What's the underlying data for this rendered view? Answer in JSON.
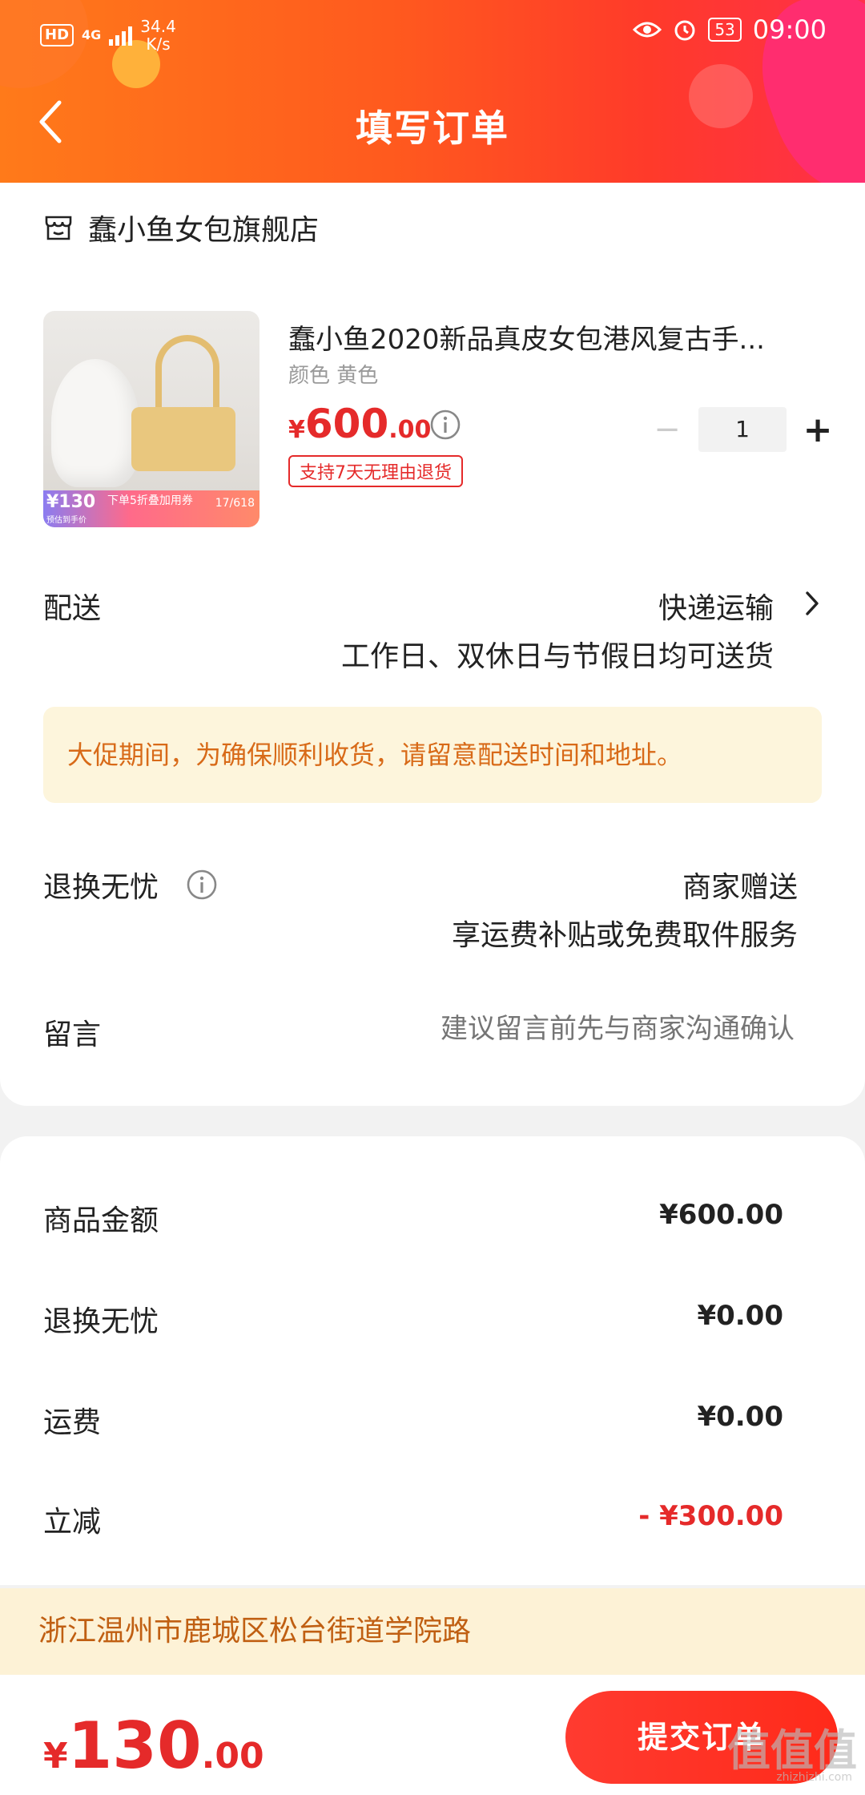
{
  "status_bar": {
    "hd": "HD",
    "network": "4G",
    "speed_value": "34.4",
    "speed_unit": "K/s",
    "battery": "53",
    "time": "09:00"
  },
  "nav": {
    "title": "填写订单"
  },
  "store": {
    "name": "蠢小鱼女包旗舰店"
  },
  "product": {
    "title": "蠢小鱼2020新品真皮女包港风复古手...",
    "spec": "颜色 黄色",
    "price_symbol": "¥",
    "price_int": "600",
    "price_dec": ".00",
    "tag": "支持7天无理由退货",
    "quantity": "1",
    "qty_minus": "−",
    "qty_plus": "+",
    "image_promo": {
      "price": "¥130",
      "sub": "预估到手价",
      "promo": "下单5折叠加用券",
      "event": "17/618"
    }
  },
  "delivery": {
    "label": "配送",
    "method": "快递运输",
    "note": "工作日、双休日与节假日均可送货"
  },
  "notice": {
    "text": "大促期间，为确保顺利收货，请留意配送时间和地址。"
  },
  "return": {
    "label": "退换无忧",
    "value": "商家赠送",
    "sub": "享运费补贴或免费取件服务"
  },
  "message": {
    "label": "留言",
    "placeholder": "建议留言前先与商家沟通确认"
  },
  "summary": {
    "items": [
      {
        "label": "商品金额",
        "value": "¥600.00"
      },
      {
        "label": "退换无忧",
        "value": "¥0.00"
      },
      {
        "label": "运费",
        "value": "¥0.00"
      },
      {
        "label": "立减",
        "value": "- ¥300.00"
      }
    ]
  },
  "address": {
    "text": "浙江温州市鹿城区松台街道学院路"
  },
  "bottom": {
    "total_symbol": "¥",
    "total_int": "130",
    "total_dec": ".00",
    "submit_label": "提交订单"
  },
  "watermark": {
    "text": "值值值",
    "sub": "zhizhizhi.com"
  },
  "colors": {
    "accent": "#e52a2a",
    "header_start": "#ff7a1a",
    "header_end": "#ff2f4a",
    "notice_bg": "#fdf5dc",
    "notice_text": "#d86a18"
  }
}
